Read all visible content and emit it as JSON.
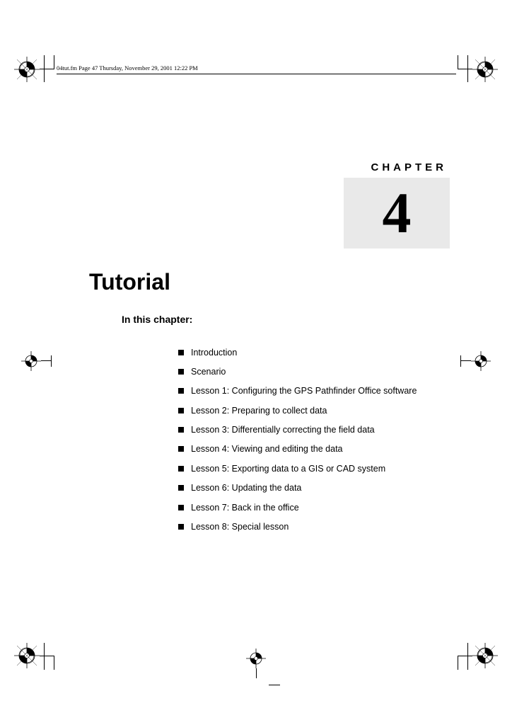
{
  "header_stamp": "04tut.fm  Page 47  Thursday, November 29, 2001  12:22 PM",
  "chapter": {
    "label": "CHAPTER",
    "number": "4"
  },
  "title": "Tutorial",
  "subhead": "In this chapter:",
  "bullets": [
    "Introduction",
    "Scenario",
    "Lesson 1: Configuring the GPS Pathfinder Office software",
    "Lesson 2: Preparing to collect data",
    "Lesson 3: Differentially correcting the field data",
    "Lesson 4: Viewing and editing the data",
    "Lesson 5: Exporting data to a GIS or CAD system",
    "Lesson 6: Updating the data",
    "Lesson 7: Back in the office",
    "Lesson 8: Special lesson"
  ]
}
